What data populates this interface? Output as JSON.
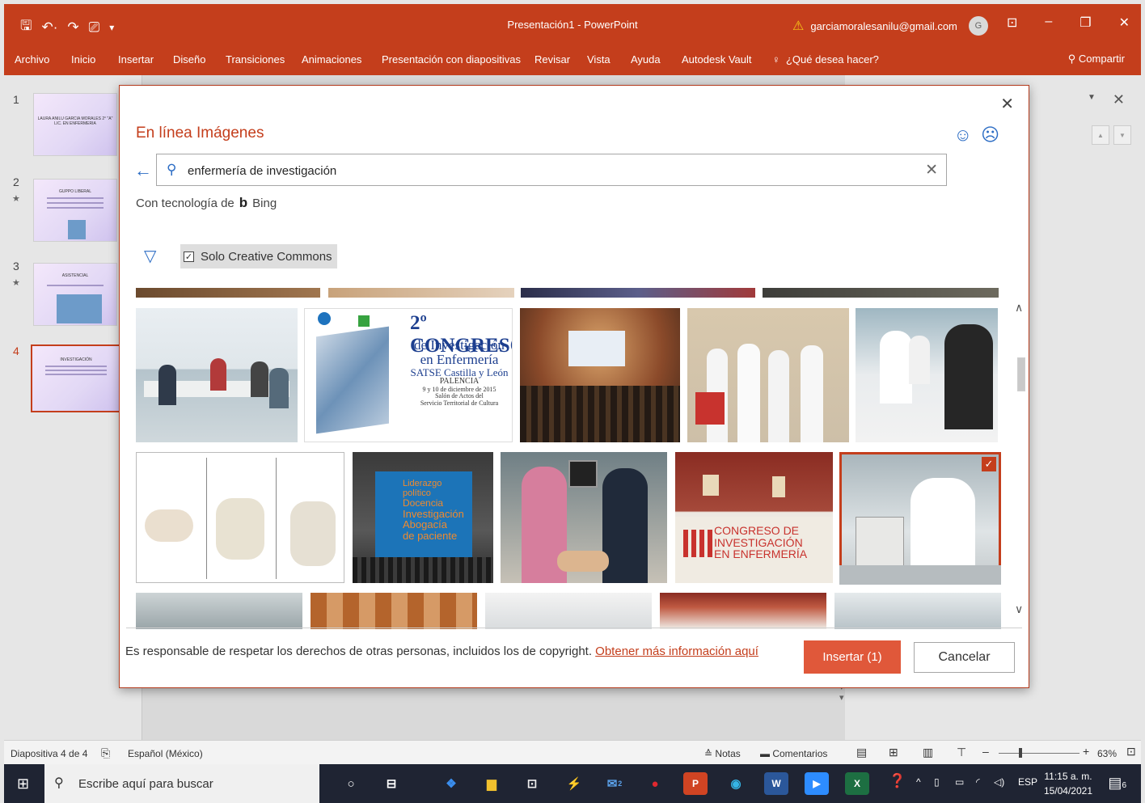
{
  "window": {
    "title": "Presentación1 - PowerPoint",
    "account_email": "garciamoralesanilu@gmail.com",
    "avatar_initial": "G",
    "accent": "#c43e1c"
  },
  "ribbon": {
    "tabs": [
      "Archivo",
      "Inicio",
      "Insertar",
      "Diseño",
      "Transiciones",
      "Animaciones",
      "Presentación con diapositivas",
      "Revisar",
      "Vista",
      "Ayuda",
      "Autodesk Vault"
    ],
    "tell_me": "¿Qué desea hacer?",
    "share": "Compartir"
  },
  "thumbnails": [
    {
      "num": "1",
      "title": "LAURA ANILU GARCIA MORALES 2° \"A\" LIC. EN ENFERMERIA",
      "star": ""
    },
    {
      "num": "2",
      "title": "GUPPO LIBERAL",
      "star": "★"
    },
    {
      "num": "3",
      "title": "ASISTENCIAL",
      "star": "★"
    },
    {
      "num": "4",
      "title": "INVESTIGACIÓN",
      "star": ""
    }
  ],
  "dialog": {
    "heading": "En línea Imágenes",
    "search_value": "enfermería de investigación",
    "powered_by": "Con tecnología de",
    "bing": "Bing",
    "filter_label": "Solo Creative Commons",
    "images": {
      "congreso_title": "2º CONGRESO",
      "congreso_lines": [
        "de Investigación",
        "en Enfermería",
        "SATSE Castilla y León",
        "PALENCIA",
        "9 y 10 de diciembre de 2015",
        "Salón de Actos del",
        "Servicio Territorial de Cultura"
      ],
      "liderazgo_lines": [
        "Liderazgo político",
        "Docencia",
        "Investigación",
        "Abogacía",
        "de paciente"
      ],
      "banner_text": [
        "CONGRESO DE",
        "INVESTIGACIÓN",
        "EN ENFERMERÍA"
      ],
      "selected_check": "✓"
    },
    "copyright_text": "Es responsable de respetar los derechos de otras personas, incluidos los de copyright.",
    "copyright_link": "Obtener más información aquí",
    "insert_label": "Insertar (1)",
    "cancel_label": "Cancelar"
  },
  "statusbar": {
    "slide_info": "Diapositiva 4 de 4",
    "language": "Español (México)",
    "notes": "Notas",
    "comments": "Comentarios",
    "zoom": "63%"
  },
  "taskbar": {
    "search_placeholder": "Escribe aquí para buscar",
    "mail_badge": "2",
    "lang": "ESP",
    "time": "11:15 a. m.",
    "date": "15/04/2021",
    "notif_count": "6"
  }
}
